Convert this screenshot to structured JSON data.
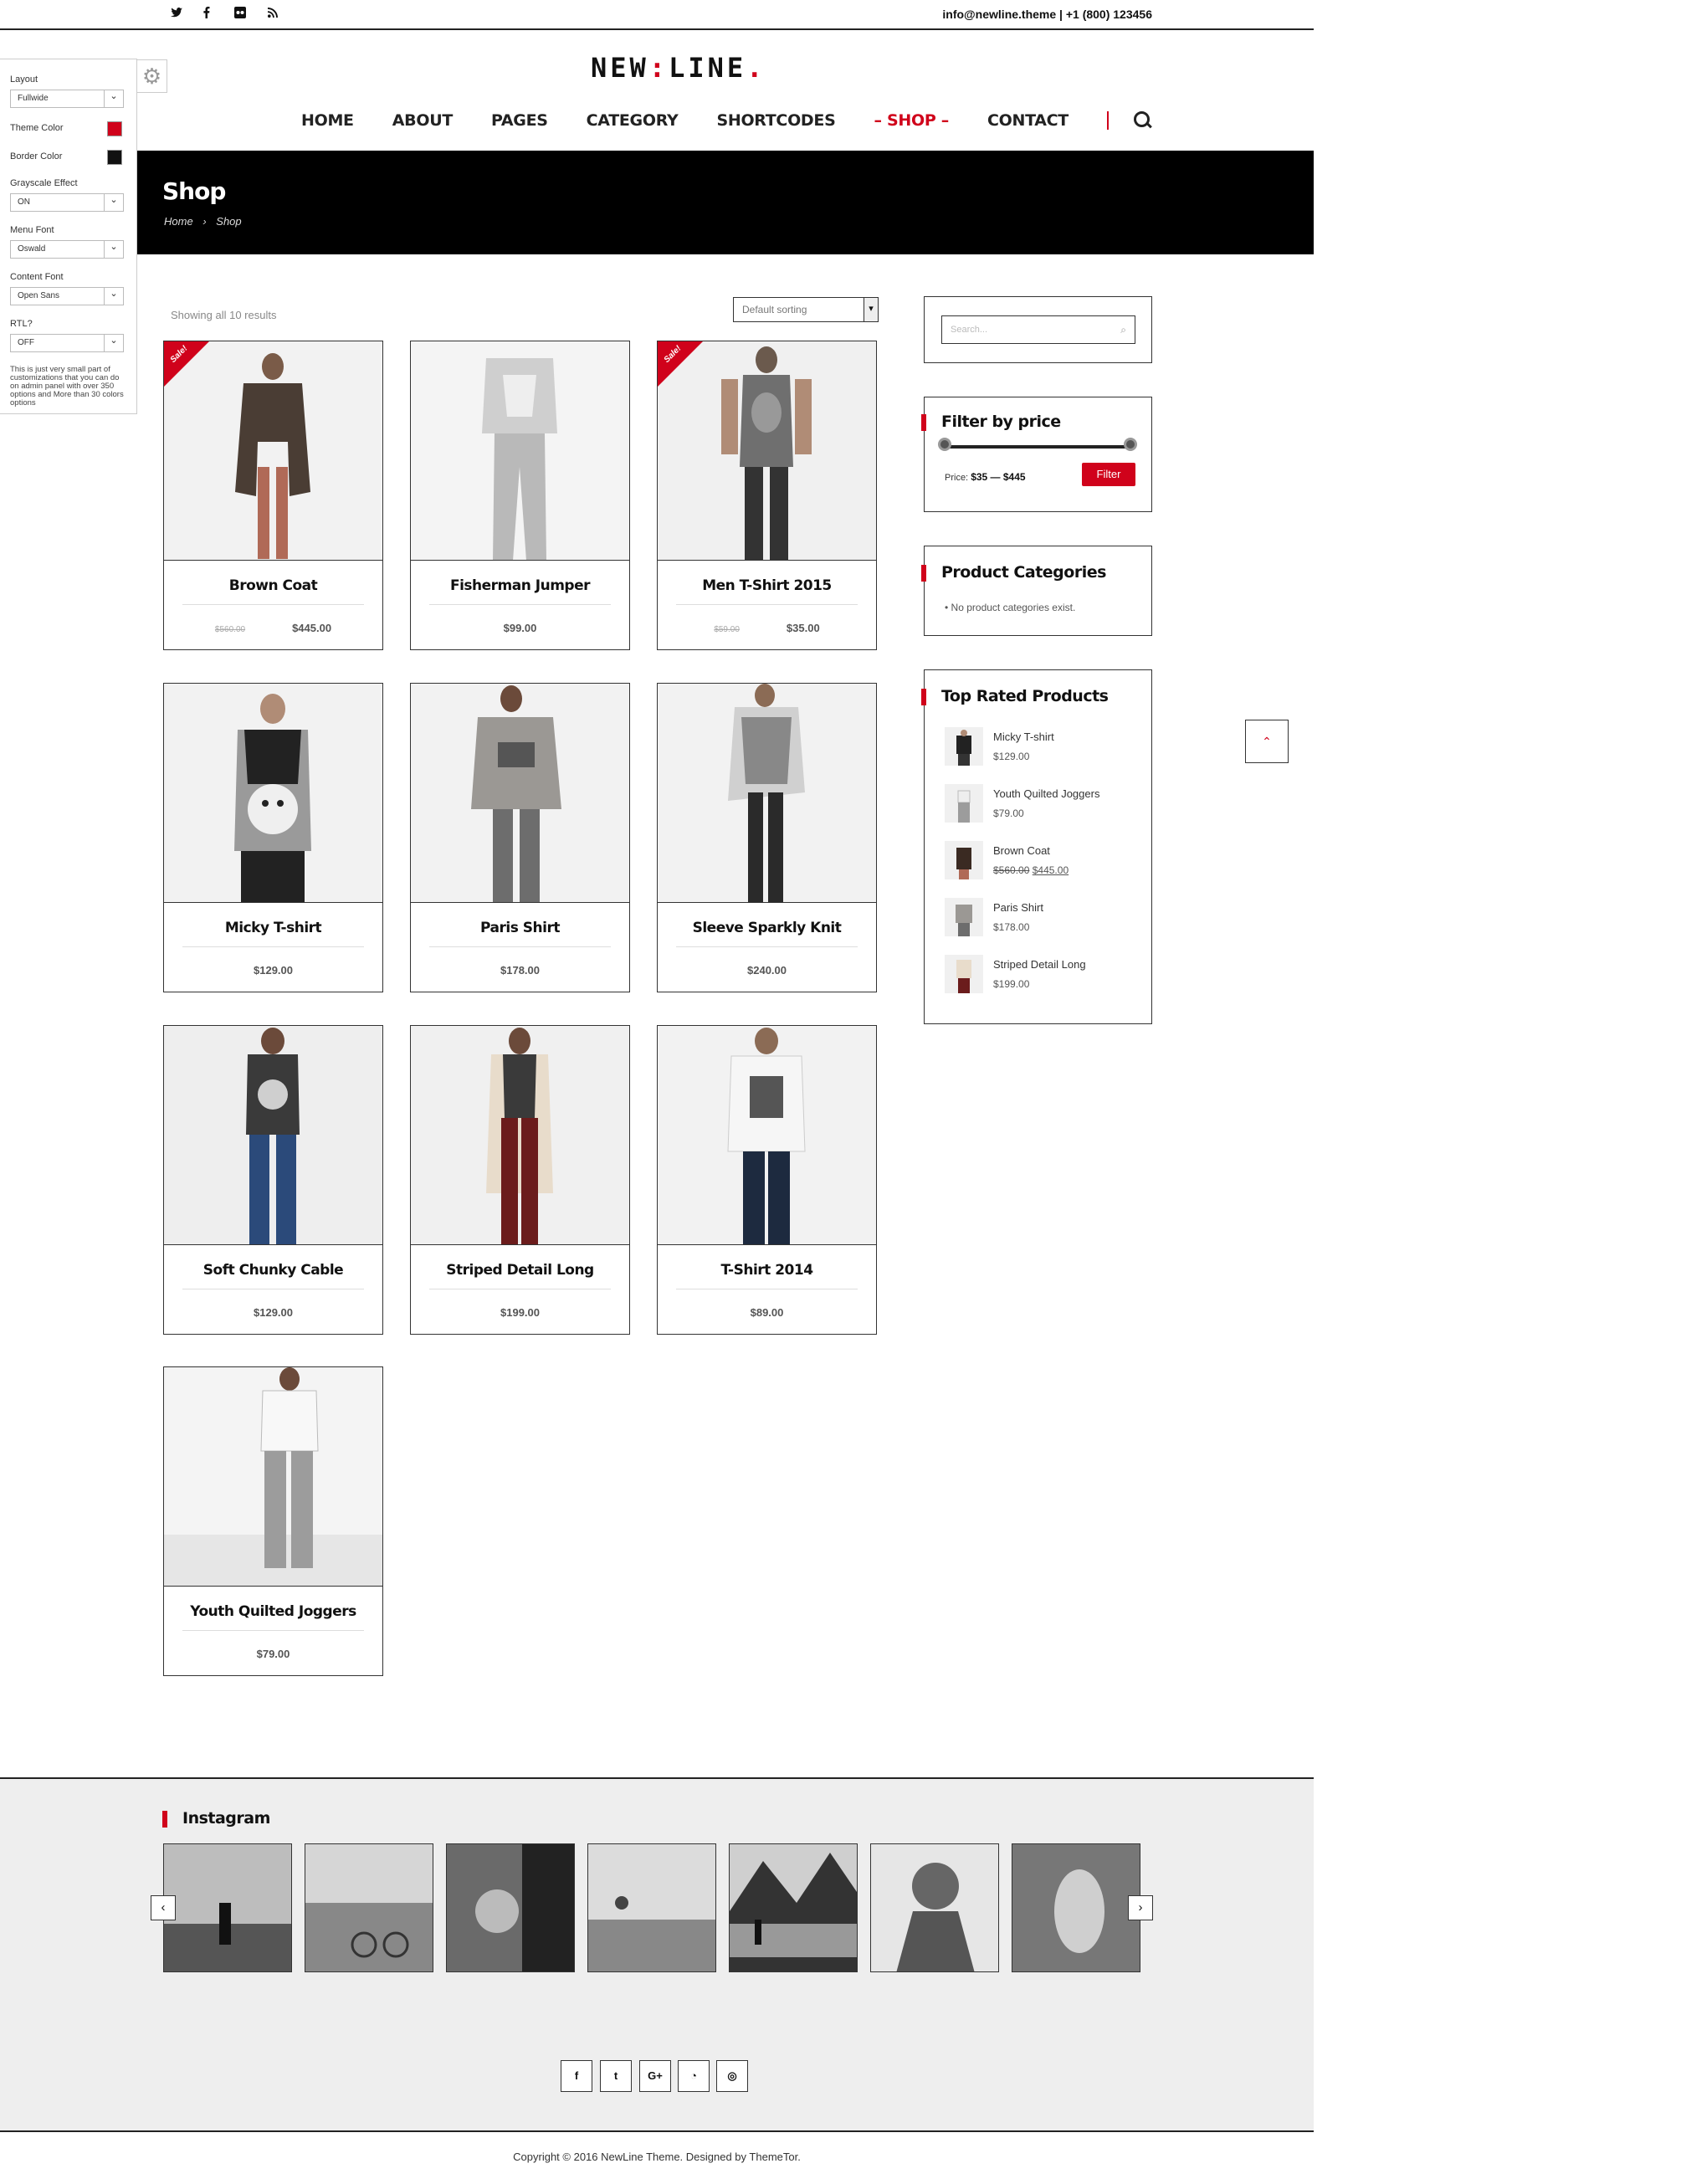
{
  "topbar": {
    "social": [
      {
        "icon": "twitter-icon",
        "glyph": "🐦"
      },
      {
        "icon": "facebook-icon",
        "glyph": "f"
      },
      {
        "icon": "flickr-icon",
        "glyph": "◉"
      },
      {
        "icon": "rss-icon",
        "glyph": "◔"
      }
    ],
    "contact": "info@newline.theme | +1 (800) 123456"
  },
  "logo": {
    "text_left": "NEW",
    "dot": ":",
    "text_right": "LINE",
    "tail": "."
  },
  "nav": {
    "items": [
      "HOME",
      "ABOUT",
      "PAGES",
      "CATEGORY",
      "SHORTCODES",
      "– SHOP –",
      "CONTACT"
    ],
    "active_index": 5
  },
  "panel": {
    "layout_label": "Layout",
    "layout_value": "Fullwide",
    "theme_color_label": "Theme Color",
    "theme_color": "#d0021b",
    "border_color_label": "Border Color",
    "border_color": "#111111",
    "grayscale_label": "Grayscale Effect",
    "grayscale_value": "ON",
    "menu_font_label": "Menu Font",
    "menu_font_value": "Oswald",
    "content_font_label": "Content Font",
    "content_font_value": "Open Sans",
    "rtl_label": "RTL?",
    "rtl_value": "OFF",
    "note": "This is just very small part of customizations that you can do on admin panel with over 350 options and More than 30 colors options"
  },
  "banner": {
    "title": "Shop",
    "crumb_home": "Home",
    "crumb_sep": "›",
    "crumb_current": "Shop"
  },
  "shop": {
    "showing": "Showing all 10 results",
    "sorting": "Default sorting",
    "sale_label": "Sale!",
    "products": [
      {
        "name": "Brown Coat",
        "old_price": "$560.00",
        "price": "$445.00",
        "sale": true
      },
      {
        "name": "Fisherman Jumper",
        "old_price": "",
        "price": "$99.00",
        "sale": false
      },
      {
        "name": "Men T-Shirt 2015",
        "old_price": "$59.00",
        "price": "$35.00",
        "sale": true
      },
      {
        "name": "Micky T-shirt",
        "old_price": "",
        "price": "$129.00",
        "sale": false
      },
      {
        "name": "Paris Shirt",
        "old_price": "",
        "price": "$178.00",
        "sale": false
      },
      {
        "name": "Sleeve Sparkly Knit",
        "old_price": "",
        "price": "$240.00",
        "sale": false
      },
      {
        "name": "Soft Chunky Cable",
        "old_price": "",
        "price": "$129.00",
        "sale": false
      },
      {
        "name": "Striped Detail Long",
        "old_price": "",
        "price": "$199.00",
        "sale": false
      },
      {
        "name": "T-Shirt 2014",
        "old_price": "",
        "price": "$89.00",
        "sale": false
      },
      {
        "name": "Youth Quilted Joggers",
        "old_price": "",
        "price": "$79.00",
        "sale": false
      }
    ]
  },
  "sidebar": {
    "search_placeholder": "Search...",
    "filter_title": "Filter by price",
    "price_prefix": "Price:",
    "price_range": "$35 — $445",
    "filter_button": "Filter",
    "categories_title": "Product Categories",
    "categories_empty": "No product categories exist.",
    "top_rated_title": "Top Rated Products",
    "top_rated": [
      {
        "name": "Micky T-shirt",
        "price": "$129.00",
        "old_price": ""
      },
      {
        "name": "Youth Quilted Joggers",
        "price": "$79.00",
        "old_price": ""
      },
      {
        "name": "Brown Coat",
        "price": "$445.00",
        "old_price": "$560.00"
      },
      {
        "name": "Paris Shirt",
        "price": "$178.00",
        "old_price": ""
      },
      {
        "name": "Striped Detail Long",
        "price": "$199.00",
        "old_price": ""
      }
    ]
  },
  "footer": {
    "instagram_title": "Instagram",
    "social": [
      {
        "icon": "facebook-icon",
        "glyph": "f"
      },
      {
        "icon": "twitter-icon",
        "glyph": "t"
      },
      {
        "icon": "google-plus-icon",
        "glyph": "G+"
      },
      {
        "icon": "rss-icon",
        "glyph": "◔"
      },
      {
        "icon": "instagram-icon",
        "glyph": "◎"
      }
    ],
    "copyright": "Copyright © 2016 NewLine Theme. Designed by ThemeTor."
  }
}
